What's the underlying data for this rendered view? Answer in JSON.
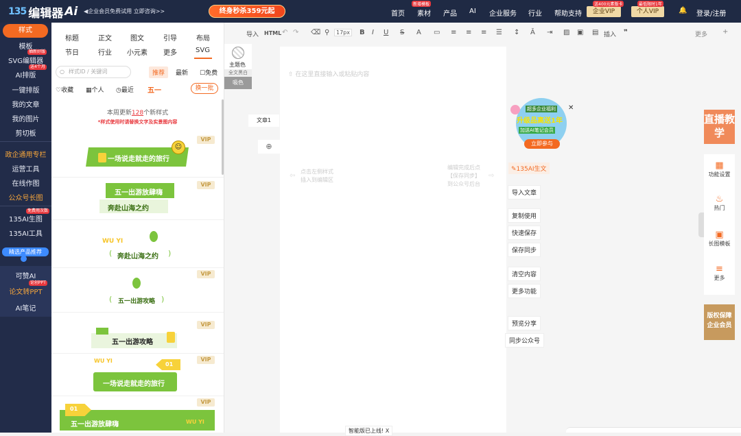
{
  "app": {
    "brand": "编辑器",
    "brand_ai": "Ai",
    "brand_logo": "135",
    "promo": "企业会员免费试用 立即咨询>>",
    "sale_banner": "终身秒杀359元起"
  },
  "topnav": {
    "items": [
      {
        "label": "首页"
      },
      {
        "label": "素材",
        "badge": "新增模板"
      },
      {
        "label": "产品"
      },
      {
        "label": "AI"
      },
      {
        "label": "企业服务"
      },
      {
        "label": "行业"
      },
      {
        "label": "帮助支持"
      }
    ],
    "enterprise_vip": "企业VIP",
    "enterprise_vip_badge": "送400元素版卡",
    "personal_vip": "个人VIP",
    "personal_vip_badge": "最低限时1年",
    "login": "登录/注册"
  },
  "leftnav": {
    "items": [
      {
        "label": "样式",
        "active": true
      },
      {
        "label": "模板"
      },
      {
        "label": "SVG编辑器",
        "badge": "抽新好版"
      },
      {
        "label": "AI排版",
        "badge": "送4个月"
      },
      {
        "label": "一键排版"
      },
      {
        "label": "我的文章"
      },
      {
        "label": "我的图片"
      },
      {
        "label": "剪切板"
      },
      {
        "label": "政企通用专栏",
        "orange": true
      },
      {
        "label": "运营工具"
      },
      {
        "label": "在线作图"
      },
      {
        "label": "公众号长图",
        "orange": true
      },
      {
        "label": "135AI生图",
        "badge": "免费用次数"
      },
      {
        "label": "135AI工具"
      },
      {
        "label": "精选产品推荐",
        "chip": true
      },
      {
        "label": "可赞AI"
      },
      {
        "label": "论文转PPT",
        "orange": true,
        "badge": "论创PPT"
      },
      {
        "label": "AI笔记"
      }
    ]
  },
  "panel": {
    "tabs_row1": [
      "标题",
      "正文",
      "图文",
      "引导",
      "布局"
    ],
    "tabs_row2": [
      "节日",
      "行业",
      "小元素",
      "更多",
      "SVG"
    ],
    "search_placeholder": "样式ID / 关键词",
    "filter_recommend": "推荐",
    "filter_latest": "最新",
    "filter_free": "免费",
    "fav": "收藏",
    "personal": "个人",
    "recent": "最近",
    "festival_tag": "五一",
    "switch": "换一批",
    "update_prefix": "本周更新",
    "update_count": "128",
    "update_suffix": "个新样式",
    "update_note": "*样式使用时请替换文字及实景图内容",
    "vip_label": "VIP",
    "styles": [
      {
        "text": "一场说走就走的旅行"
      },
      {
        "text": "五一出游放肆嗨",
        "sub": "奔赴山海之约"
      },
      {
        "text": "奔赴山海之约",
        "deco": "WU YI"
      },
      {
        "text": "五一出游攻略"
      },
      {
        "text": "五一出游攻略"
      },
      {
        "text": "一场说走就走的旅行",
        "deco": "WU YI",
        "num": "01"
      },
      {
        "text": "五一出游放肆嗨",
        "deco": "WU YI",
        "num": "01"
      }
    ]
  },
  "toolbar": {
    "import": "导入",
    "html": "HTML",
    "fontsize": "17px",
    "insert": "插入",
    "more": "更多"
  },
  "editor": {
    "theme_color": "主题色",
    "full_white": "全文黑白",
    "pick_color": "吸色",
    "article_tab": "文章1",
    "placeholder": "在这里直接输入或粘贴内容",
    "hint_left": "点击左侧样式\n插入到编辑区",
    "hint_right": "编辑完成后点\n【保存同步】\n到公众号后台",
    "ai_article": "135AI生文",
    "actions": [
      "导入文章",
      "复制使用",
      "快速保存",
      "保存同步",
      "清空内容",
      "更多功能",
      "预览分享",
      "同步公众号"
    ],
    "promo_title": "升级品高送1年",
    "promo_sub": "加送AI笔记会员",
    "promo_btn": "立即参与",
    "promo_top": "超多企业福利",
    "bottom_notice": "智能版已上线!"
  },
  "rail": {
    "live": "直播教学",
    "items": [
      {
        "label": "功能设置"
      },
      {
        "label": "热门"
      },
      {
        "label": "长图模板"
      },
      {
        "label": "更多"
      }
    ],
    "copyright": "版权保障企业会员"
  },
  "colors": {
    "accent": "#f36a22",
    "nav_bg": "#222c49",
    "topbar_bg": "#1f2a44",
    "green": "#7cc43d",
    "yellow": "#f7d23a"
  }
}
